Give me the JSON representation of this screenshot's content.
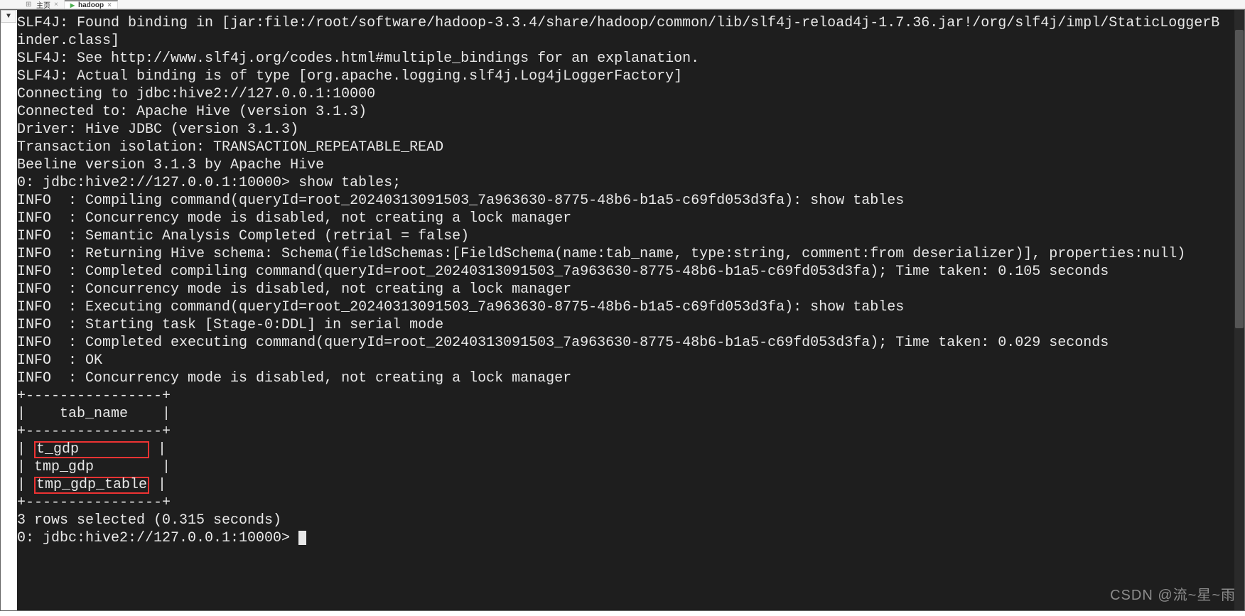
{
  "tabs": {
    "tab1": {
      "label": "主页"
    },
    "tab2": {
      "label": "hadoop"
    }
  },
  "terminal": {
    "l1": "SLF4J: Found binding in [jar:file:/root/software/hadoop-3.3.4/share/hadoop/common/lib/slf4j-reload4j-1.7.36.jar!/org/slf4j/impl/StaticLoggerB",
    "l2": "inder.class]",
    "l3": "SLF4J: See http://www.slf4j.org/codes.html#multiple_bindings for an explanation.",
    "l4": "SLF4J: Actual binding is of type [org.apache.logging.slf4j.Log4jLoggerFactory]",
    "l5": "Connecting to jdbc:hive2://127.0.0.1:10000",
    "l6": "Connected to: Apache Hive (version 3.1.3)",
    "l7": "Driver: Hive JDBC (version 3.1.3)",
    "l8": "Transaction isolation: TRANSACTION_REPEATABLE_READ",
    "l9": "Beeline version 3.1.3 by Apache Hive",
    "l10": "0: jdbc:hive2://127.0.0.1:10000> show tables;",
    "l11": "INFO  : Compiling command(queryId=root_20240313091503_7a963630-8775-48b6-b1a5-c69fd053d3fa): show tables",
    "l12": "INFO  : Concurrency mode is disabled, not creating a lock manager",
    "l13": "INFO  : Semantic Analysis Completed (retrial = false)",
    "l14": "INFO  : Returning Hive schema: Schema(fieldSchemas:[FieldSchema(name:tab_name, type:string, comment:from deserializer)], properties:null)",
    "l15": "INFO  : Completed compiling command(queryId=root_20240313091503_7a963630-8775-48b6-b1a5-c69fd053d3fa); Time taken: 0.105 seconds",
    "l16": "INFO  : Concurrency mode is disabled, not creating a lock manager",
    "l17": "INFO  : Executing command(queryId=root_20240313091503_7a963630-8775-48b6-b1a5-c69fd053d3fa): show tables",
    "l18": "INFO  : Starting task [Stage-0:DDL] in serial mode",
    "l19": "INFO  : Completed executing command(queryId=root_20240313091503_7a963630-8775-48b6-b1a5-c69fd053d3fa); Time taken: 0.029 seconds",
    "l20": "INFO  : OK",
    "l21": "INFO  : Concurrency mode is disabled, not creating a lock manager",
    "l22": "+----------------+",
    "l23": "|    tab_name    |",
    "l24": "+----------------+",
    "table_row1": "t_gdp        ",
    "table_row2": "| tmp_gdp        |",
    "table_row3": "tmp_gdp_table",
    "l28": "+----------------+",
    "l29": "3 rows selected (0.315 seconds)",
    "l30": "0: jdbc:hive2://127.0.0.1:10000> "
  },
  "watermark": "CSDN @流~星~雨"
}
